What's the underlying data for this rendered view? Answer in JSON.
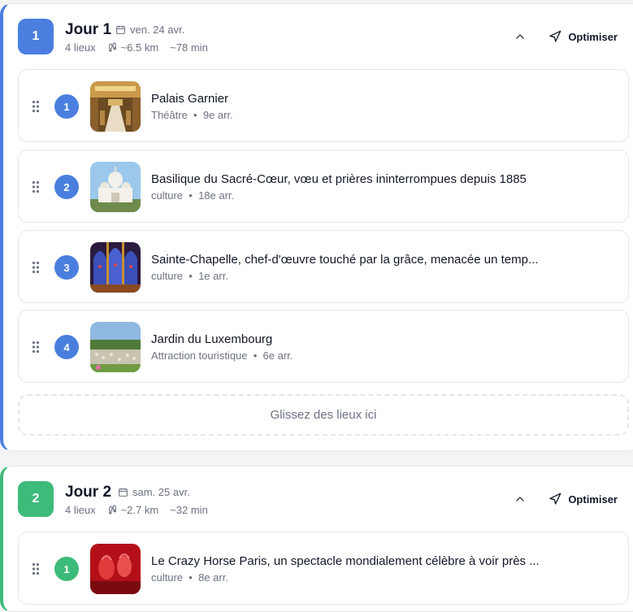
{
  "colors": {
    "day1_accent": "#4a7fe0",
    "day2_accent": "#3dbb7a"
  },
  "days": [
    {
      "badge": "1",
      "title": "Jour 1",
      "date": "ven. 24 avr.",
      "places_count": "4 lieux",
      "distance": "~6.5 km",
      "duration": "~78 min",
      "optimize_label": "Optimiser",
      "dropzone_label": "Glissez des lieux ici",
      "places": [
        {
          "order": "1",
          "name": "Palais Garnier",
          "category": "Théâtre",
          "district": "9e arr.",
          "image": "palais-garnier-photo"
        },
        {
          "order": "2",
          "name": "Basilique du Sacré-Cœur, vœu et prières ininterrompues depuis 1885",
          "category": "culture",
          "district": "18e arr.",
          "image": "sacre-coeur-photo"
        },
        {
          "order": "3",
          "name": "Sainte-Chapelle, chef-d'œuvre touché par la grâce, menacée un temp...",
          "category": "culture",
          "district": "1e arr.",
          "image": "sainte-chapelle-photo"
        },
        {
          "order": "4",
          "name": "Jardin du Luxembourg",
          "category": "Attraction touristique",
          "district": "6e arr.",
          "image": "jardin-luxembourg-photo"
        }
      ]
    },
    {
      "badge": "2",
      "title": "Jour 2",
      "date": "sam. 25 avr.",
      "places_count": "4 lieux",
      "distance": "~2.7 km",
      "duration": "~32 min",
      "optimize_label": "Optimiser",
      "places": [
        {
          "order": "1",
          "name": "Le Crazy Horse Paris, un spectacle mondialement célèbre à voir près ...",
          "category": "culture",
          "district": "8e arr.",
          "image": "crazy-horse-photo"
        }
      ]
    }
  ],
  "separator": "•"
}
